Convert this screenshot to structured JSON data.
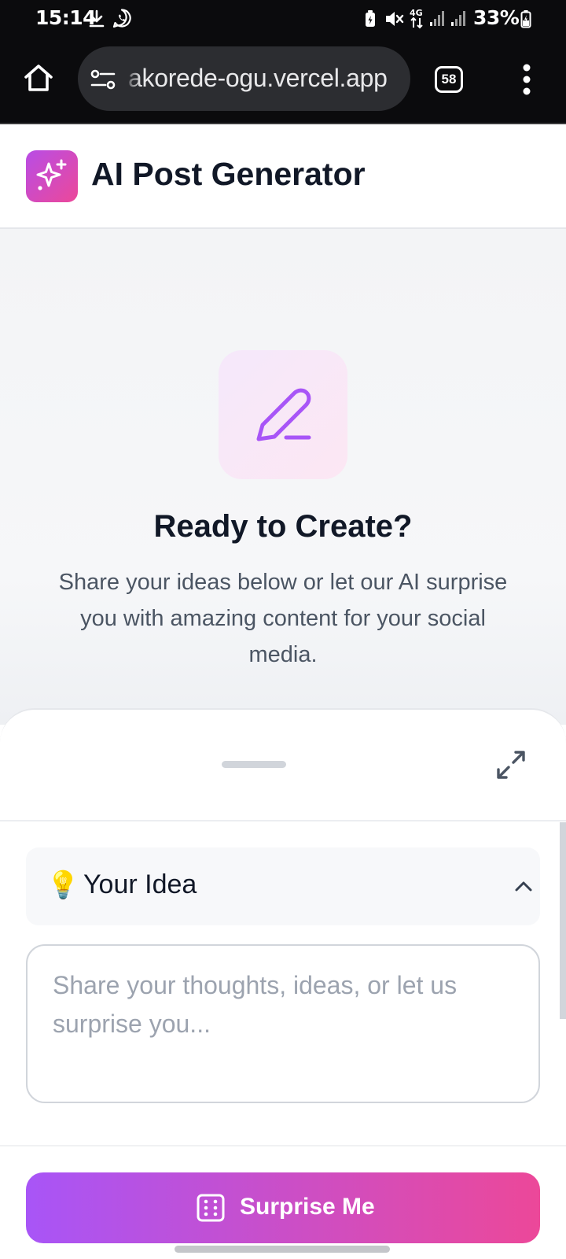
{
  "status_bar": {
    "time": "15:14",
    "battery": "33%",
    "icons": [
      "download-icon",
      "whatsapp-icon",
      "battery-saver-icon",
      "mute-icon",
      "4g-icon",
      "signal-icon",
      "signal-icon",
      "battery-icon"
    ]
  },
  "browser": {
    "url": "akorede-ogu.vercel.app",
    "tab_count": "58",
    "icons": [
      "home-icon",
      "site-settings-icon",
      "menu-dots-icon"
    ]
  },
  "app": {
    "title": "AI Post Generator",
    "logo_icon": "sparkles-icon"
  },
  "hero": {
    "icon": "pen-icon",
    "title": "Ready to Create?",
    "subtitle": "Share your ideas below or let our AI surprise you with amazing content for your social media."
  },
  "idea_section": {
    "emoji": "💡",
    "title": "Your Idea",
    "placeholder": "Share your thoughts, ideas, or let us surprise you...",
    "value": ""
  },
  "footer": {
    "surprise_label": "Surprise Me",
    "surprise_icon": "dice-icon"
  },
  "colors": {
    "accent_start": "#a855f7",
    "accent_end": "#ec4899",
    "status_bar": "#0b0b0d",
    "text_primary": "#111827",
    "text_secondary": "#4b5563",
    "placeholder": "#9ca3af"
  }
}
